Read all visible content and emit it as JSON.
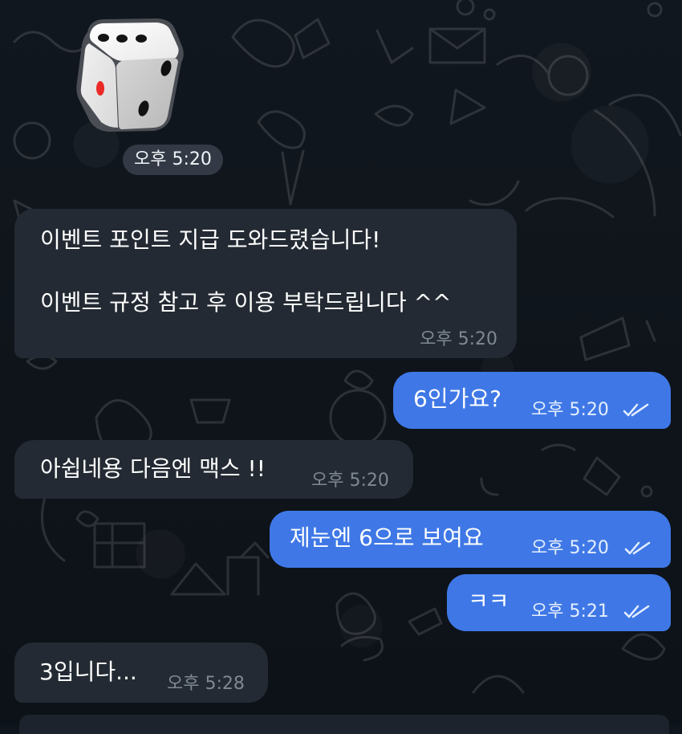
{
  "dice": {
    "label": "dice",
    "top_face_value": 3,
    "left_face_value": 1,
    "right_face_value": 2
  },
  "first_time": "오후 5:20",
  "messages": [
    {
      "direction": "incoming",
      "lines": [
        "이벤트 포인트 지급 도와드렸습니다!",
        "",
        "이벤트 규정 참고 후 이용 부탁드립니다 ^^"
      ],
      "time": "오후 5:20"
    },
    {
      "direction": "outgoing",
      "text": "6인가요?",
      "time": "오후 5:20",
      "read": true
    },
    {
      "direction": "incoming",
      "text": "아쉽네용 다음엔 맥스 !!",
      "time": "오후 5:20"
    },
    {
      "direction": "outgoing",
      "text": "제눈엔 6으로 보여요",
      "time": "오후 5:20",
      "read": true
    },
    {
      "direction": "outgoing",
      "text": "ㅋㅋ",
      "time": "오후 5:21",
      "read": true
    },
    {
      "direction": "incoming",
      "text": "3입니다...",
      "time": "오후 5:28"
    }
  ],
  "colors": {
    "background": "#0f151c",
    "incoming_bubble": "#232a33",
    "outgoing_bubble": "#3f78e6",
    "meta_incoming": "#7f8893",
    "meta_outgoing": "#e6efff"
  }
}
